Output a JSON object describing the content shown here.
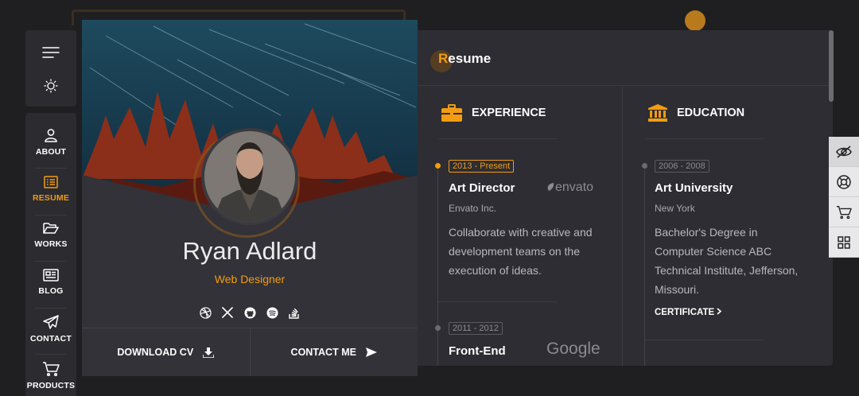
{
  "nav": {
    "items": [
      {
        "label": "ABOUT",
        "icon": "user-icon"
      },
      {
        "label": "RESUME",
        "icon": "resume-icon",
        "active": true
      },
      {
        "label": "WORKS",
        "icon": "folder-icon"
      },
      {
        "label": "BLOG",
        "icon": "newspaper-icon"
      },
      {
        "label": "CONTACT",
        "icon": "paper-plane-icon"
      },
      {
        "label": "PRODUCTS",
        "icon": "cart-icon"
      }
    ]
  },
  "profile": {
    "name": "Ryan Adlard",
    "role": "Web Designer",
    "download_label": "DOWNLOAD CV",
    "contact_label": "CONTACT ME"
  },
  "resume": {
    "title_first": "R",
    "title_rest": "esume",
    "experience": {
      "heading": "EXPERIENCE",
      "entries": [
        {
          "date": "2013 - Present",
          "title": "Art Director",
          "org": "Envato Inc.",
          "brand": "envato",
          "desc": "Collaborate with creative and development teams on the execution of ideas."
        },
        {
          "date": "2011 - 2012",
          "title": "Front-End",
          "brand": "Google"
        }
      ]
    },
    "education": {
      "heading": "EDUCATION",
      "entries": [
        {
          "date": "2006 - 2008",
          "title": "Art University",
          "org": "New York",
          "desc": "Bachelor's Degree in Computer Science ABC Technical Institute, Jefferson, Missouri.",
          "link": "CERTIFICATE"
        }
      ]
    }
  },
  "colors": {
    "accent": "#f39c12",
    "panel": "#2d2d33",
    "background": "#1f1f22"
  }
}
